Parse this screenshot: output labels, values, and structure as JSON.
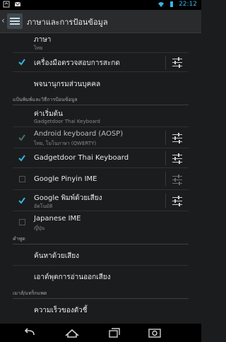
{
  "status_bar": {
    "time": "22:12"
  },
  "action_bar": {
    "title": "ภาษาและการป้อนข้อมูล"
  },
  "items": {
    "language": {
      "label": "ภาษา",
      "value": "ไทย"
    },
    "spell_checker": {
      "label": "เครื่องมือตรวจสอบการสะกด",
      "checked": true
    },
    "personal_dictionary": {
      "label": "พจนานุกรมส่วนบุคคล"
    }
  },
  "keyboard_section": {
    "header": "แป้นพิมพ์และวิธีการป้อนข้อมูล",
    "default": {
      "label": "ค่าเริ่มต้น",
      "value": "Gadgetdoor Thai Keyboard"
    },
    "methods": [
      {
        "label": "Android keyboard (AOSP)",
        "sub": "ไทย, โมโนภาษา (QWERTY)",
        "checked": true,
        "enabled": false,
        "settings": true
      },
      {
        "label": "Gadgetdoor Thai Keyboard",
        "sub": "",
        "checked": true,
        "enabled": true,
        "settings": true
      },
      {
        "label": "Google Pinyin IME",
        "sub": "",
        "checked": false,
        "enabled": true,
        "settings": true
      },
      {
        "label": "Google พิมพ์ด้วยเสียง",
        "sub": "อัตโนมัติ",
        "checked": true,
        "enabled": true,
        "settings": true
      },
      {
        "label": "Japanese IME",
        "sub": "ญี่ปุ่น",
        "checked": false,
        "enabled": true,
        "settings": false
      }
    ]
  },
  "speech_section": {
    "header": "คำพูด",
    "voice_search": "ค้นหาด้วยเสียง",
    "tts_output": "เอาต์พุตการอ่านออกเสียง"
  },
  "mouse_section": {
    "header": "เมาส์/แทร็กแพด",
    "pointer_speed": "ความเร็วของตัวชี้"
  },
  "colors": {
    "accent": "#33b5e5",
    "background": "#1b1c1d"
  },
  "nav_bar": {
    "icons": [
      "back-icon",
      "home-icon",
      "recent-apps-icon",
      "screenshot-icon"
    ]
  }
}
